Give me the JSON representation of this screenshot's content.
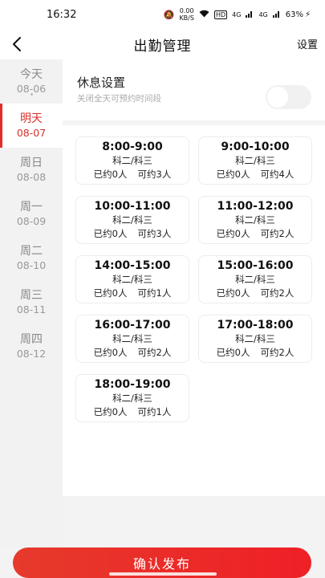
{
  "status_bar": {
    "time": "16:32",
    "speed": "0.00",
    "speed_unit": "KB/S",
    "hd": "HD",
    "network_1": "4G",
    "network_2": "4G",
    "battery": "63%"
  },
  "header": {
    "title": "出勤管理",
    "settings_label": "设置"
  },
  "sidebar": {
    "days": [
      {
        "name": "今天",
        "date": "08-06"
      },
      {
        "name": "明天",
        "date": "08-07"
      },
      {
        "name": "周日",
        "date": "08-08"
      },
      {
        "name": "周一",
        "date": "08-09"
      },
      {
        "name": "周二",
        "date": "08-10"
      },
      {
        "name": "周三",
        "date": "08-11"
      },
      {
        "name": "周四",
        "date": "08-12"
      }
    ],
    "active_index": 1
  },
  "rest": {
    "title": "休息设置",
    "subtitle": "关闭全天可预约时间段",
    "enabled": false
  },
  "slots": [
    {
      "time": "8:00-9:00",
      "subject": "科二/科三",
      "booked": "已约0人",
      "available": "可约3人"
    },
    {
      "time": "9:00-10:00",
      "subject": "科二/科三",
      "booked": "已约0人",
      "available": "可约4人"
    },
    {
      "time": "10:00-11:00",
      "subject": "科二/科三",
      "booked": "已约0人",
      "available": "可约3人"
    },
    {
      "time": "11:00-12:00",
      "subject": "科二/科三",
      "booked": "已约0人",
      "available": "可约2人"
    },
    {
      "time": "14:00-15:00",
      "subject": "科二/科三",
      "booked": "已约0人",
      "available": "可约1人"
    },
    {
      "time": "15:00-16:00",
      "subject": "科二/科三",
      "booked": "已约0人",
      "available": "可约2人"
    },
    {
      "time": "16:00-17:00",
      "subject": "科二/科三",
      "booked": "已约0人",
      "available": "可约2人"
    },
    {
      "time": "17:00-18:00",
      "subject": "科二/科三",
      "booked": "已约0人",
      "available": "可约2人"
    },
    {
      "time": "18:00-19:00",
      "subject": "科二/科三",
      "booked": "已约0人",
      "available": "可约1人"
    }
  ],
  "footer": {
    "confirm_label": "确认发布"
  },
  "colors": {
    "accent": "#e52d27"
  }
}
